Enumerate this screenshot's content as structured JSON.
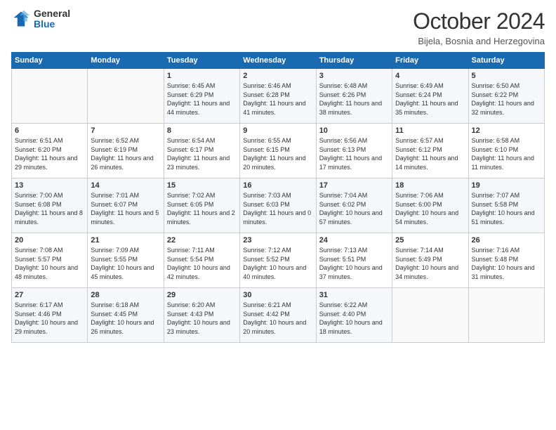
{
  "logo": {
    "general": "General",
    "blue": "Blue"
  },
  "title": "October 2024",
  "subtitle": "Bijela, Bosnia and Herzegovina",
  "headers": [
    "Sunday",
    "Monday",
    "Tuesday",
    "Wednesday",
    "Thursday",
    "Friday",
    "Saturday"
  ],
  "weeks": [
    [
      {
        "day": "",
        "info": ""
      },
      {
        "day": "",
        "info": ""
      },
      {
        "day": "1",
        "info": "Sunrise: 6:45 AM\nSunset: 6:29 PM\nDaylight: 11 hours and 44 minutes."
      },
      {
        "day": "2",
        "info": "Sunrise: 6:46 AM\nSunset: 6:28 PM\nDaylight: 11 hours and 41 minutes."
      },
      {
        "day": "3",
        "info": "Sunrise: 6:48 AM\nSunset: 6:26 PM\nDaylight: 11 hours and 38 minutes."
      },
      {
        "day": "4",
        "info": "Sunrise: 6:49 AM\nSunset: 6:24 PM\nDaylight: 11 hours and 35 minutes."
      },
      {
        "day": "5",
        "info": "Sunrise: 6:50 AM\nSunset: 6:22 PM\nDaylight: 11 hours and 32 minutes."
      }
    ],
    [
      {
        "day": "6",
        "info": "Sunrise: 6:51 AM\nSunset: 6:20 PM\nDaylight: 11 hours and 29 minutes."
      },
      {
        "day": "7",
        "info": "Sunrise: 6:52 AM\nSunset: 6:19 PM\nDaylight: 11 hours and 26 minutes."
      },
      {
        "day": "8",
        "info": "Sunrise: 6:54 AM\nSunset: 6:17 PM\nDaylight: 11 hours and 23 minutes."
      },
      {
        "day": "9",
        "info": "Sunrise: 6:55 AM\nSunset: 6:15 PM\nDaylight: 11 hours and 20 minutes."
      },
      {
        "day": "10",
        "info": "Sunrise: 6:56 AM\nSunset: 6:13 PM\nDaylight: 11 hours and 17 minutes."
      },
      {
        "day": "11",
        "info": "Sunrise: 6:57 AM\nSunset: 6:12 PM\nDaylight: 11 hours and 14 minutes."
      },
      {
        "day": "12",
        "info": "Sunrise: 6:58 AM\nSunset: 6:10 PM\nDaylight: 11 hours and 11 minutes."
      }
    ],
    [
      {
        "day": "13",
        "info": "Sunrise: 7:00 AM\nSunset: 6:08 PM\nDaylight: 11 hours and 8 minutes."
      },
      {
        "day": "14",
        "info": "Sunrise: 7:01 AM\nSunset: 6:07 PM\nDaylight: 11 hours and 5 minutes."
      },
      {
        "day": "15",
        "info": "Sunrise: 7:02 AM\nSunset: 6:05 PM\nDaylight: 11 hours and 2 minutes."
      },
      {
        "day": "16",
        "info": "Sunrise: 7:03 AM\nSunset: 6:03 PM\nDaylight: 11 hours and 0 minutes."
      },
      {
        "day": "17",
        "info": "Sunrise: 7:04 AM\nSunset: 6:02 PM\nDaylight: 10 hours and 57 minutes."
      },
      {
        "day": "18",
        "info": "Sunrise: 7:06 AM\nSunset: 6:00 PM\nDaylight: 10 hours and 54 minutes."
      },
      {
        "day": "19",
        "info": "Sunrise: 7:07 AM\nSunset: 5:58 PM\nDaylight: 10 hours and 51 minutes."
      }
    ],
    [
      {
        "day": "20",
        "info": "Sunrise: 7:08 AM\nSunset: 5:57 PM\nDaylight: 10 hours and 48 minutes."
      },
      {
        "day": "21",
        "info": "Sunrise: 7:09 AM\nSunset: 5:55 PM\nDaylight: 10 hours and 45 minutes."
      },
      {
        "day": "22",
        "info": "Sunrise: 7:11 AM\nSunset: 5:54 PM\nDaylight: 10 hours and 42 minutes."
      },
      {
        "day": "23",
        "info": "Sunrise: 7:12 AM\nSunset: 5:52 PM\nDaylight: 10 hours and 40 minutes."
      },
      {
        "day": "24",
        "info": "Sunrise: 7:13 AM\nSunset: 5:51 PM\nDaylight: 10 hours and 37 minutes."
      },
      {
        "day": "25",
        "info": "Sunrise: 7:14 AM\nSunset: 5:49 PM\nDaylight: 10 hours and 34 minutes."
      },
      {
        "day": "26",
        "info": "Sunrise: 7:16 AM\nSunset: 5:48 PM\nDaylight: 10 hours and 31 minutes."
      }
    ],
    [
      {
        "day": "27",
        "info": "Sunrise: 6:17 AM\nSunset: 4:46 PM\nDaylight: 10 hours and 29 minutes."
      },
      {
        "day": "28",
        "info": "Sunrise: 6:18 AM\nSunset: 4:45 PM\nDaylight: 10 hours and 26 minutes."
      },
      {
        "day": "29",
        "info": "Sunrise: 6:20 AM\nSunset: 4:43 PM\nDaylight: 10 hours and 23 minutes."
      },
      {
        "day": "30",
        "info": "Sunrise: 6:21 AM\nSunset: 4:42 PM\nDaylight: 10 hours and 20 minutes."
      },
      {
        "day": "31",
        "info": "Sunrise: 6:22 AM\nSunset: 4:40 PM\nDaylight: 10 hours and 18 minutes."
      },
      {
        "day": "",
        "info": ""
      },
      {
        "day": "",
        "info": ""
      }
    ]
  ]
}
